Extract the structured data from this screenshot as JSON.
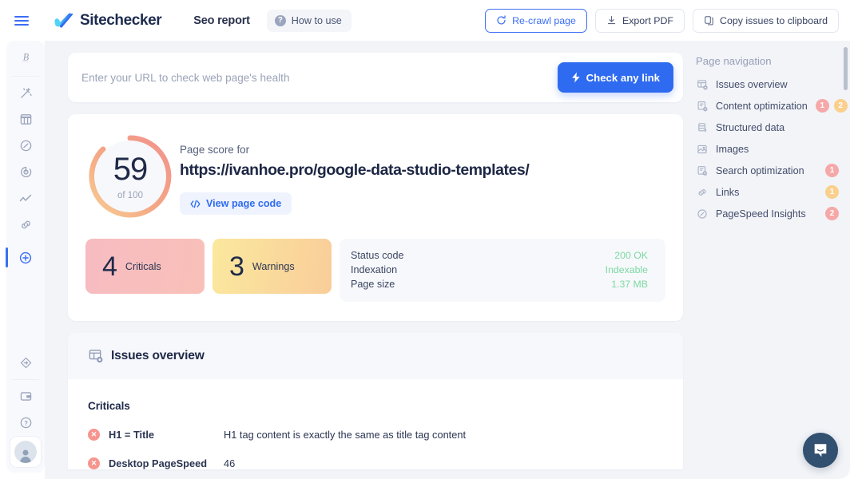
{
  "topbar": {
    "menu_icon": "hamburger-icon",
    "brand": "Sitechecker",
    "nav_title": "Seo report",
    "howto_label": "How to use",
    "howto_icon": "question-circle-icon",
    "actions": [
      {
        "label": "Re-crawl page",
        "icon": "refresh-icon",
        "style": "primary"
      },
      {
        "label": "Export PDF",
        "icon": "download-icon",
        "style": "default"
      },
      {
        "label": "Copy issues to clipboard",
        "icon": "copy-icon",
        "style": "default"
      }
    ]
  },
  "rail": {
    "items": [
      {
        "name": "sidebar-item-brand",
        "icon": "script-letter-icon",
        "active": false
      },
      {
        "name": "sidebar-item-magic",
        "icon": "magic-wand-icon",
        "active": false
      },
      {
        "name": "sidebar-item-columns",
        "icon": "columns-icon",
        "active": false
      },
      {
        "name": "sidebar-item-speed",
        "icon": "gauge-icon",
        "active": false
      },
      {
        "name": "sidebar-item-monitor",
        "icon": "radar-icon",
        "active": false
      },
      {
        "name": "sidebar-item-rankings",
        "icon": "trend-line-icon",
        "active": false
      },
      {
        "name": "sidebar-item-links",
        "icon": "link-icon",
        "active": false
      },
      {
        "name": "sidebar-item-add",
        "icon": "plus-circle-icon",
        "active": true
      },
      {
        "name": "sidebar-item-tools",
        "icon": "diamond-arrow-icon",
        "active": false
      },
      {
        "name": "sidebar-item-billing",
        "icon": "wallet-icon",
        "active": false
      },
      {
        "name": "sidebar-item-help",
        "icon": "question-circle-icon",
        "active": false
      }
    ],
    "avatar": "user-avatar"
  },
  "search": {
    "placeholder": "Enter your URL to check web page's health",
    "value": "",
    "button_label": "Check any link",
    "button_icon": "lightning-icon"
  },
  "score": {
    "value": "59",
    "of": "of 100",
    "percent": 59,
    "label": "Page score for",
    "url": "https://ivanhoe.pro/google-data-studio-templates/",
    "view_code_label": "View page code",
    "view_code_icon": "code-icon",
    "arc_start_color": "#f2928c",
    "arc_end_color": "#f7c992",
    "stats": [
      {
        "count": "4",
        "label": "Criticals",
        "color": "#f7bcc1"
      },
      {
        "count": "3",
        "label": "Warnings",
        "color": "#fbe89e"
      }
    ],
    "info": [
      {
        "key": "Status code",
        "value": "200 OK"
      },
      {
        "key": "Indexation",
        "value": "Indexable"
      },
      {
        "key": "Page size",
        "value": "1.37 MB"
      }
    ],
    "info_value_color": "#7cd9a4"
  },
  "issues": {
    "header": "Issues overview",
    "header_icon": "issues-overview-icon",
    "section_title": "Criticals",
    "rows": [
      {
        "name": "H1 = Title",
        "desc": "H1 tag content is exactly the same as title tag content"
      },
      {
        "name": "Desktop PageSpeed",
        "desc": "46"
      }
    ]
  },
  "page_nav": {
    "title": "Page navigation",
    "items": [
      {
        "label": "Issues overview",
        "icon": "issues-overview-icon",
        "badges": []
      },
      {
        "label": "Content optimization",
        "icon": "content-doc-icon",
        "badges": [
          {
            "text": "1",
            "type": "red"
          },
          {
            "text": "2",
            "type": "yellow"
          }
        ]
      },
      {
        "label": "Structured data",
        "icon": "database-icon",
        "badges": []
      },
      {
        "label": "Images",
        "icon": "image-icon",
        "badges": []
      },
      {
        "label": "Search optimization",
        "icon": "search-doc-icon",
        "badges": [
          {
            "text": "1",
            "type": "red"
          }
        ]
      },
      {
        "label": "Links",
        "icon": "link-icon",
        "badges": [
          {
            "text": "1",
            "type": "yellow"
          }
        ]
      },
      {
        "label": "PageSpeed Insights",
        "icon": "speed-gauge-icon",
        "badges": [
          {
            "text": "2",
            "type": "red"
          }
        ]
      }
    ]
  },
  "chat": {
    "icon": "intercom-chat-icon"
  }
}
